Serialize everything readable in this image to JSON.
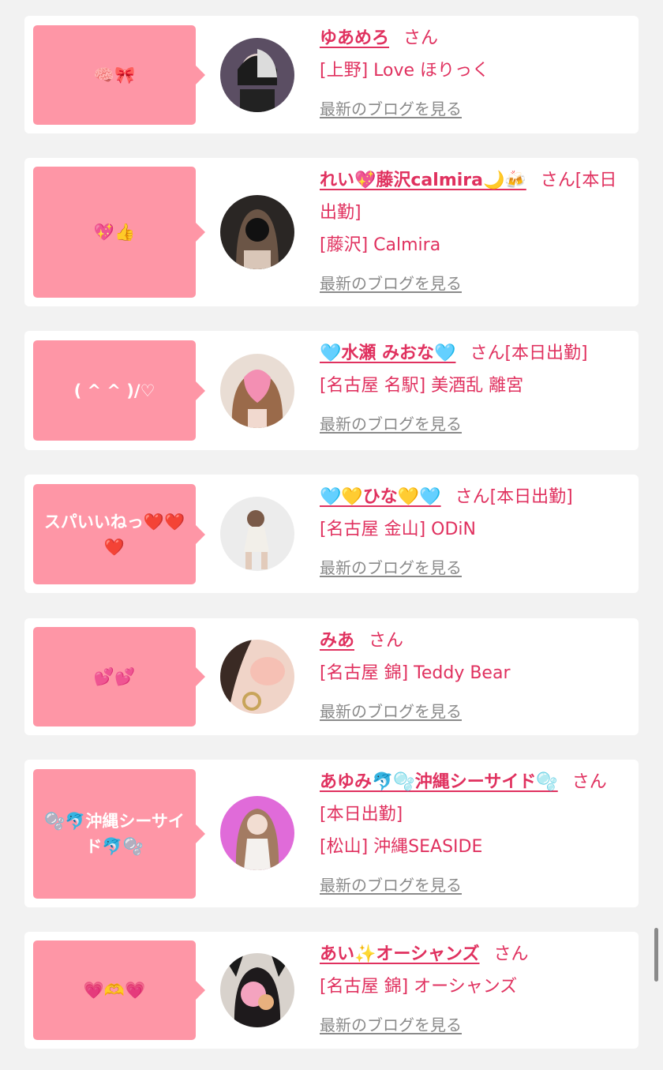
{
  "colors": {
    "bubble": "#fe96a6",
    "name": "#e0315f",
    "link": "#8a8a8a",
    "background": "#f2f2f2"
  },
  "blog_link_label": "最新のブログを見る",
  "entries": [
    {
      "comment": "🧠🎀",
      "name": "ゆあめろ",
      "suffix": "さん",
      "shop": "[上野] Love ほりっく",
      "avatar_icon": "portrait-photo"
    },
    {
      "comment": "💖👍",
      "name": "れい💖藤沢calmira🌙🍻",
      "suffix": "さん[本日出勤]",
      "shop": "[藤沢] Calmira",
      "avatar_icon": "portrait-photo"
    },
    {
      "comment": "( ^ ^ )/♡",
      "name": "🩵水瀬 みおな🩵",
      "suffix": "さん[本日出勤]",
      "shop": "[名古屋 名駅] 美酒乱 離宮",
      "avatar_icon": "portrait-photo"
    },
    {
      "comment": "スパいいねっ❤️❤️❤️",
      "name": "🩵💛ひな💛🩵",
      "suffix": "さん[本日出勤]",
      "shop": "[名古屋 金山] ODiN",
      "avatar_icon": "portrait-photo"
    },
    {
      "comment": "💕💕",
      "name": "みあ",
      "suffix": "さん",
      "shop": "[名古屋 錦] Teddy Bear",
      "avatar_icon": "portrait-photo"
    },
    {
      "comment": "🫧🐬沖縄シーサイド🐬🫧",
      "name": "あゆみ🐬🫧沖縄シーサイド🫧",
      "suffix": "さん[本日出勤]",
      "shop": "[松山] 沖縄SEASIDE",
      "avatar_icon": "portrait-photo"
    },
    {
      "comment": "💗🫶💗",
      "name": "あい✨オーシャンズ",
      "suffix": "さん",
      "shop": "[名古屋 錦] オーシャンズ",
      "avatar_icon": "portrait-photo"
    }
  ]
}
